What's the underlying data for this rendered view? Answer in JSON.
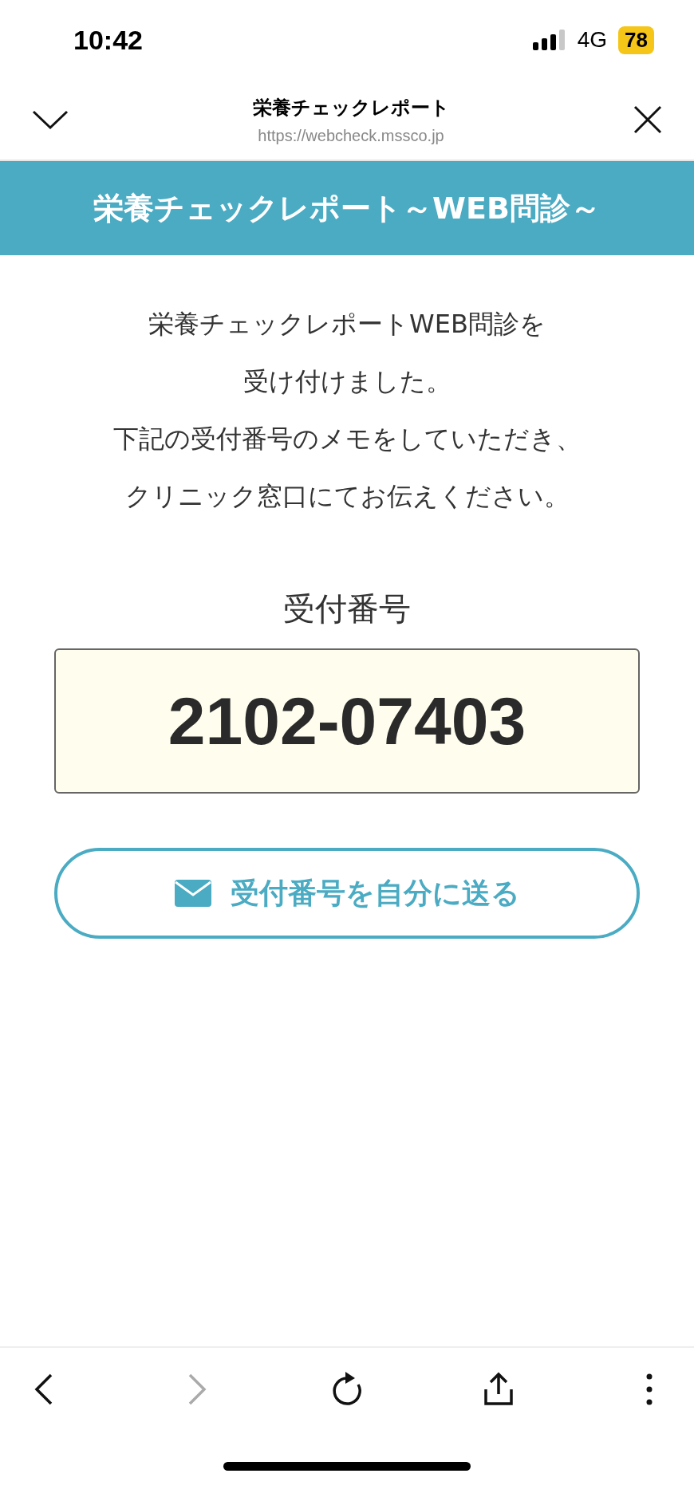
{
  "status_bar": {
    "time": "10:42",
    "network": "4G",
    "battery": "78"
  },
  "browser_header": {
    "title": "栄養チェックレポート",
    "url": "https://webcheck.mssco.jp"
  },
  "banner": {
    "title": "栄養チェックレポート～WEB問診～"
  },
  "message": [
    "栄養チェックレポートWEB問診を",
    "受け付けました。",
    "下記の受付番号のメモをしていただき、",
    "クリニック窓口にてお伝えください。"
  ],
  "receipt": {
    "label": "受付番号",
    "number": "2102-07403"
  },
  "send_button": {
    "label": "受付番号を自分に送る"
  },
  "toolbar": [
    {
      "kind": "back",
      "disabled": false
    },
    {
      "kind": "forward",
      "disabled": true
    },
    {
      "kind": "reload",
      "disabled": false
    },
    {
      "kind": "share",
      "disabled": false
    },
    {
      "kind": "more",
      "disabled": false
    }
  ]
}
